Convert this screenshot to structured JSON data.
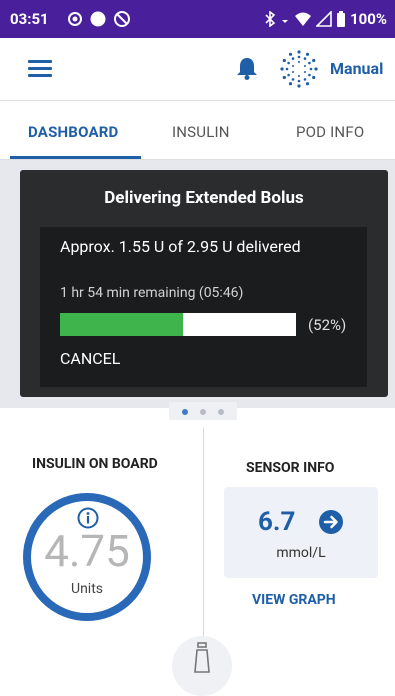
{
  "status_bar": {
    "time": "03:51",
    "battery": "100%",
    "icons": [
      "circle-outline-icon",
      "circle-filled-icon",
      "do-not-disturb-icon",
      "bluetooth-icon",
      "data-arrows-icon",
      "wifi-icon",
      "signal-icon",
      "battery-icon"
    ]
  },
  "app_bar": {
    "mode_label": "Manual",
    "icons": [
      "menu-icon",
      "bell-icon",
      "automated-mode-icon"
    ],
    "accent_color": "#1f5fa8"
  },
  "tabs": [
    {
      "label": "DASHBOARD",
      "active": true
    },
    {
      "label": "INSULIN",
      "active": false
    },
    {
      "label": "POD INFO",
      "active": false
    }
  ],
  "bolus_dialog": {
    "title": "Delivering Extended Bolus",
    "approx_text": "Approx. 1.55 U of 2.95 U delivered",
    "remaining_text": "1 hr 54 min remaining (05:46)",
    "progress_percent": 52,
    "progress_label": "(52%)",
    "cancel_label": "CANCEL",
    "progress_color": "#3fb44c"
  },
  "pager": {
    "count": 3,
    "active_index": 0
  },
  "insulin_on_board": {
    "title": "INSULIN ON BOARD",
    "value": "4.75",
    "units": "Units"
  },
  "sensor_info": {
    "title": "SENSOR INFO",
    "value": "6.7",
    "unit": "mmol/L",
    "view_graph_label": "VIEW GRAPH"
  }
}
